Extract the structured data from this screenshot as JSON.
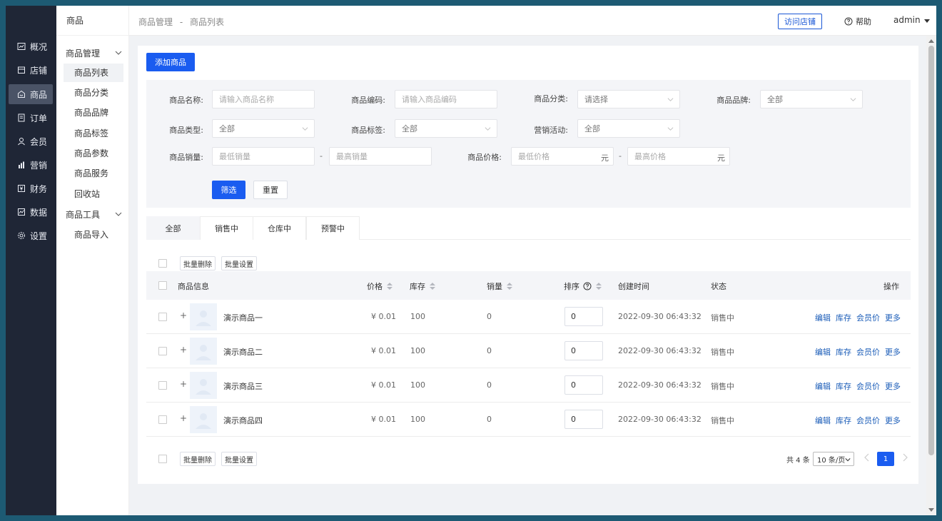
{
  "nav": {
    "items": [
      {
        "label": "概况",
        "icon": "overview-icon"
      },
      {
        "label": "店铺",
        "icon": "store-icon"
      },
      {
        "label": "商品",
        "icon": "goods-icon"
      },
      {
        "label": "订单",
        "icon": "order-icon"
      },
      {
        "label": "会员",
        "icon": "member-icon"
      },
      {
        "label": "营销",
        "icon": "marketing-icon"
      },
      {
        "label": "财务",
        "icon": "finance-icon"
      },
      {
        "label": "数据",
        "icon": "data-icon"
      },
      {
        "label": "设置",
        "icon": "settings-icon"
      }
    ],
    "active_index": 2
  },
  "sidebar": {
    "title": "商品",
    "group1": "商品管理",
    "items1": [
      "商品列表",
      "商品分类",
      "商品品牌",
      "商品标签",
      "商品参数",
      "商品服务",
      "回收站"
    ],
    "group2": "商品工具",
    "items2": [
      "商品导入"
    ]
  },
  "header": {
    "breadcrumb": [
      "商品管理",
      "-",
      "商品列表"
    ],
    "visit_store": "访问店铺",
    "help": "帮助",
    "user": "admin"
  },
  "toolbar": {
    "add": "添加商品"
  },
  "filter": {
    "name_label": "商品名称:",
    "name_placeholder": "请输入商品名称",
    "code_label": "商品编码:",
    "code_placeholder": "请输入商品编码",
    "category_label": "商品分类:",
    "category_value": "请选择",
    "brand_label": "商品品牌:",
    "brand_value": "全部",
    "type_label": "商品类型:",
    "type_value": "全部",
    "tag_label": "商品标签:",
    "tag_value": "全部",
    "promo_label": "营销活动:",
    "promo_value": "全部",
    "sales_label": "商品销量:",
    "sales_min": "最低销量",
    "sales_max": "最高销量",
    "dash": "-",
    "price_label": "商品价格:",
    "price_min": "最低价格",
    "price_max": "最高价格",
    "unit": "元",
    "search": "筛选",
    "reset": "重置"
  },
  "tabs": [
    "全部",
    "销售中",
    "仓库中",
    "预警中"
  ],
  "batch": {
    "delete": "批量删除",
    "settings": "批量设置"
  },
  "table": {
    "headers": {
      "info": "商品信息",
      "price": "价格",
      "stock": "库存",
      "sales": "销量",
      "sort": "排序",
      "created": "创建时间",
      "status": "状态",
      "ops": "操作"
    },
    "rows": [
      {
        "name": "演示商品一",
        "price": "¥ 0.01",
        "stock": "100",
        "sales": "0",
        "sort": "0",
        "created": "2022-09-30 06:43:32",
        "status": "销售中"
      },
      {
        "name": "演示商品二",
        "price": "¥ 0.01",
        "stock": "100",
        "sales": "0",
        "sort": "0",
        "created": "2022-09-30 06:43:32",
        "status": "销售中"
      },
      {
        "name": "演示商品三",
        "price": "¥ 0.01",
        "stock": "100",
        "sales": "0",
        "sort": "0",
        "created": "2022-09-30 06:43:32",
        "status": "销售中"
      },
      {
        "name": "演示商品四",
        "price": "¥ 0.01",
        "stock": "100",
        "sales": "0",
        "sort": "0",
        "created": "2022-09-30 06:43:32",
        "status": "销售中"
      }
    ],
    "row_ops": [
      "编辑",
      "库存",
      "会员价",
      "更多"
    ],
    "expand": "+"
  },
  "pager": {
    "total": "共 4 条",
    "size": "10 条/页",
    "page": "1"
  },
  "colors": {
    "primary": "#1a5cf0",
    "nav_bg": "#1f2636",
    "link": "#1a5cb8"
  }
}
